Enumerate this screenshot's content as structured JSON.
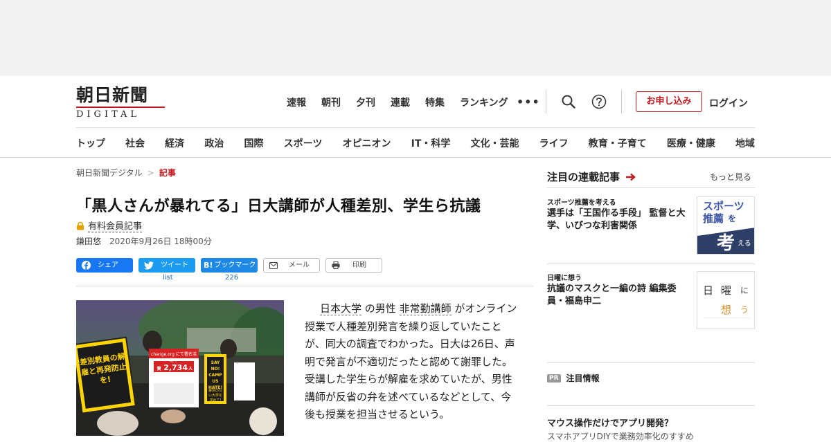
{
  "header": {
    "logo_main": "朝日新聞",
    "logo_sub": "DIGITAL",
    "top_nav": [
      "速報",
      "朝刊",
      "夕刊",
      "連載",
      "特集",
      "ランキング"
    ],
    "more": "•••",
    "subscribe_label": "お申し込み",
    "login_label": "ログイン",
    "categories": [
      "トップ",
      "社会",
      "経済",
      "政治",
      "国際",
      "スポーツ",
      "オピニオン",
      "IT・科学",
      "文化・芸能",
      "ライフ",
      "教育・子育て",
      "医療・健康",
      "地域"
    ]
  },
  "breadcrumb": {
    "home": "朝日新聞デジタル",
    "sep": ">",
    "current": "記事"
  },
  "article": {
    "headline": "「黒人さんが暴れてる」日大講師が人種差別、学生ら抗議",
    "paid_label": "有料会員記事",
    "author": "鎌田悠",
    "datetime": "2020年9月26日 18時00分",
    "share": {
      "facebook": "シェア",
      "twitter": "ツイート",
      "twitter_count": "list",
      "hatena": "ブックマーク",
      "hatena_count": "226",
      "mail": "メール",
      "print": "印刷"
    },
    "body": {
      "link1": "日本大学",
      "t1": "の男性",
      "link2": "非常勤講師",
      "t2": "がオンライン授業で人種差別発言を繰り返していたことが、同大の調査でわかった。日大は26日、声明で発言が不適切だったと認めて謝罪した。受講した学生らが解雇を求めていたが、男性講師が反省の弁を述べているなどとして、今後も授業を担当させるという。"
    },
    "photo": {
      "sign1": "差別教員の解雇と再発防止を!",
      "sign2_top": "change.org にて署名活動中",
      "sign2_label": "賛同者",
      "sign2_count": "2,734",
      "sign2_unit": "人",
      "sign3": "SAY NO! CAMPUS HATE!",
      "sign3_sub": "差別のない大学を求めて!"
    }
  },
  "sidebar": {
    "heading": "注目の連載記事",
    "more": "もっと見る",
    "items": [
      {
        "tag": "スポーツ推薦を考える",
        "title": "選手は「王国作る手段」 監督と大学、いびつな利害関係",
        "thumb_a": "スポーツ",
        "thumb_b": "推薦",
        "thumb_c": "を",
        "thumb_d": "考",
        "thumb_e": "える"
      },
      {
        "tag": "日曜に想う",
        "title": "抗議のマスクと一編の詩 編集委員・福島申二",
        "thumb_a": "日",
        "thumb_b": "曜",
        "thumb_c": "に",
        "thumb_d": "想",
        "thumb_e": "う"
      }
    ],
    "pr_badge": "PR",
    "pr_heading": "注目情報",
    "pr_title": "マウス操作だけでアプリ開発？",
    "pr_sub": "スマホアプリDIYで業務効率化のすすめ"
  },
  "colors": {
    "brand_red": "#c4171c",
    "facebook": "#1877f2",
    "twitter": "#1d9bf0",
    "hatena": "#1e88e5"
  }
}
